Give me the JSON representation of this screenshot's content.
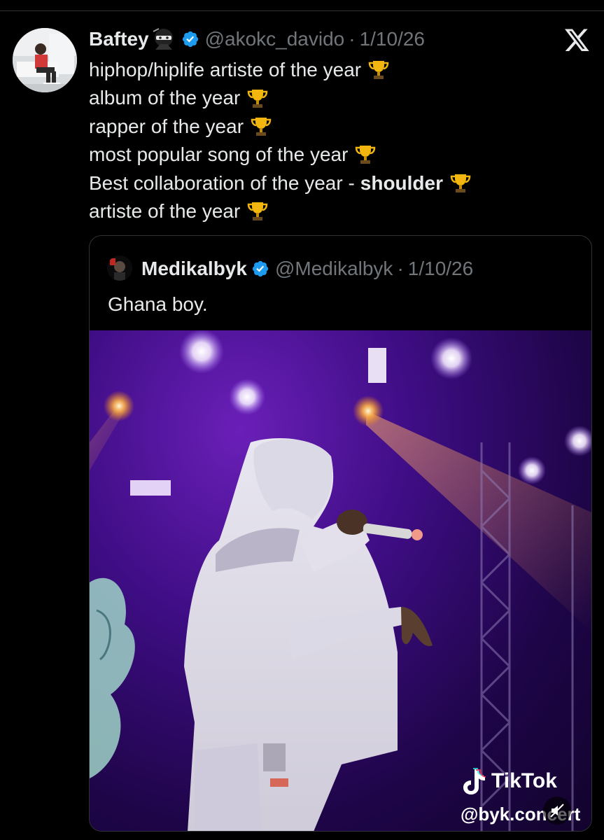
{
  "post": {
    "author_name": "Baftey",
    "handle": "@akokc_davido",
    "separator": "·",
    "date": "1/10/26",
    "lines": [
      {
        "text": "hiphop/hiplife artiste of the year"
      },
      {
        "text": "album of the year"
      },
      {
        "text": "rapper of the year"
      },
      {
        "text": "most popular song of the year"
      },
      {
        "text": "Best collaboration of the year -",
        "bold": "shoulder"
      },
      {
        "text": "artiste of the year"
      }
    ]
  },
  "quoted": {
    "author_name": "Medikalbyk",
    "handle": "@Medikalbyk",
    "separator": "·",
    "date": "1/10/26",
    "text": "Ghana boy.",
    "watermark_brand": "TikTok",
    "watermark_handle": "@byk.concert"
  },
  "icons": {
    "close": "x-logo-close-icon",
    "verified": "verified-badge-icon",
    "trophy": "trophy-emoji-icon",
    "ninja": "ninja-emoji-icon",
    "mute": "muted-speaker-icon"
  },
  "colors": {
    "background": "#000000",
    "text": "#e7e9ea",
    "muted": "#71767b",
    "verified": "#1d9bf0",
    "border": "#2f3336"
  }
}
